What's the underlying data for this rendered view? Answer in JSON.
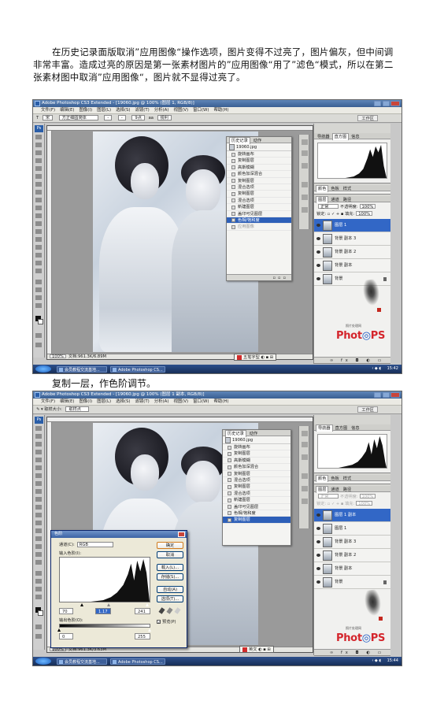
{
  "intro_text": "在历史记录面版取消”应用图像“操作选项，图片变得不过亮了，图片偏灰，但中间调非常丰富。造成过亮的原因是第一张素材图片的”应用图像“用了”滤色“模式，所以在第二张素材图中取消”应用图像“，图片就不显得过亮了。",
  "caption2": "复制一层，作色阶调节。",
  "screens": [
    {
      "title": "Adobe Photoshop CS3 Extended - [19060.jpg @ 100% (图层 1, RGB/8)]",
      "menu": [
        "文件(F)",
        "编辑(E)",
        "图像(I)",
        "图层(L)",
        "选择(S)",
        "滤镜(T)",
        "分析(A)",
        "视图(V)",
        "窗口(W)",
        "帮助(H)"
      ],
      "options": [
        "T",
        "宋",
        "方正细圆简体",
        "-",
        "-",
        "9点",
        "aa",
        "锐利"
      ],
      "workspace": "工作区",
      "history": {
        "tabs": [
          "历史记录",
          "动作"
        ],
        "snapshot": "19060.jpg",
        "rows": [
          {
            "label": "旋转画布",
            "state": ""
          },
          {
            "label": "复制图层",
            "state": ""
          },
          {
            "label": "高斯模糊",
            "state": ""
          },
          {
            "label": "颜色加深混合",
            "state": ""
          },
          {
            "label": "复制图层",
            "state": ""
          },
          {
            "label": "混合选项",
            "state": ""
          },
          {
            "label": "复制图层",
            "state": ""
          },
          {
            "label": "混合选项",
            "state": ""
          },
          {
            "label": "新建图层",
            "state": ""
          },
          {
            "label": "盖印可见图层",
            "state": ""
          },
          {
            "label": "色相/饱和度",
            "state": "sel"
          },
          {
            "label": "应用图像",
            "state": "dim"
          }
        ]
      },
      "nav_tabs": [
        "导航器",
        "直方图",
        "信息"
      ],
      "color_tabs": [
        "颜色",
        "色板",
        "样式"
      ],
      "layers_tabs": [
        "图层",
        "通道",
        "路径"
      ],
      "blend": "正常",
      "opacity_label": "不透明度:",
      "opacity": "100%",
      "lock_label": "锁定:",
      "fill_label": "填充:",
      "fill": "100%",
      "layers": [
        {
          "name": "图层 1",
          "sel": true
        },
        {
          "name": "背景 副本 3",
          "sel": false
        },
        {
          "name": "背景 副本 2",
          "sel": false
        },
        {
          "name": "背景 副本",
          "sel": false
        },
        {
          "name": "背景",
          "sel": false,
          "lock": true
        }
      ],
      "zoom": "100%",
      "doc": "文档:961.3K/6.89M",
      "lang": "五笔字型",
      "logo_sub": "照片处理网",
      "logo_a": "Phot",
      "logo_b": "PS",
      "start_task": "会员教程交流基地...",
      "ps_task": "Adobe Photoshop CS...",
      "clock": "15:42"
    },
    {
      "title": "Adobe Photoshop CS3 Extended - [19060.jpg @ 100% (图层 1 副本, RGB/8)]",
      "menu": [
        "文件(F)",
        "编辑(E)",
        "图像(I)",
        "图层(L)",
        "选择(S)",
        "滤镜(T)",
        "分析(A)",
        "视图(V)",
        "窗口(W)",
        "帮助(H)"
      ],
      "options": [
        "取样大小:",
        "取样点"
      ],
      "workspace": "工作区",
      "history": {
        "tabs": [
          "历史记录",
          "动作"
        ],
        "snapshot": "19060.jpg",
        "rows": [
          {
            "label": "旋转画布",
            "state": ""
          },
          {
            "label": "复制图层",
            "state": ""
          },
          {
            "label": "高斯模糊",
            "state": ""
          },
          {
            "label": "颜色加深混合",
            "state": ""
          },
          {
            "label": "复制图层",
            "state": ""
          },
          {
            "label": "混合选项",
            "state": ""
          },
          {
            "label": "复制图层",
            "state": ""
          },
          {
            "label": "混合选项",
            "state": ""
          },
          {
            "label": "新建图层",
            "state": ""
          },
          {
            "label": "盖印可见图层",
            "state": ""
          },
          {
            "label": "色相/饱和度",
            "state": ""
          },
          {
            "label": "复制图层",
            "state": "sel"
          }
        ]
      },
      "nav_tabs": [
        "导航器",
        "直方图",
        "信息"
      ],
      "color_tabs": [
        "颜色",
        "色板",
        "样式"
      ],
      "layers_tabs": [
        "图层",
        "通道",
        "路径"
      ],
      "blend": "正常",
      "opacity_label": "不透明度:",
      "opacity": "100%",
      "lock_label": "锁定:",
      "fill_label": "填充:",
      "fill": "100%",
      "layers": [
        {
          "name": "图层 1 副本",
          "sel": true
        },
        {
          "name": "图层 1",
          "sel": false
        },
        {
          "name": "背景 副本 3",
          "sel": false
        },
        {
          "name": "背景 副本 2",
          "sel": false
        },
        {
          "name": "背景 副本",
          "sel": false
        },
        {
          "name": "背景",
          "sel": false,
          "lock": true
        }
      ],
      "zoom": "100%",
      "doc": "文档:961.3K/3.63M",
      "lang": "英文",
      "logo_sub": "照片处理网",
      "logo_a": "Phot",
      "logo_b": "PS",
      "start_task": "会员教程交流基地...",
      "ps_task": "Adobe Photoshop CS...",
      "clock": "15:44",
      "levels": {
        "title": "色阶",
        "channel_label": "通道(C):",
        "channel": "RGB",
        "input_label": "输入色阶(I):",
        "input_black": "70",
        "input_gray": "1.17",
        "input_white": "241",
        "output_label": "输出色阶(O):",
        "output_black": "0",
        "output_white": "255",
        "buttons": [
          "确定",
          "取消",
          "载入(L)...",
          "存储(S)...",
          "自动(A)",
          "选项(T)..."
        ],
        "preview": "预览(P)"
      }
    }
  ]
}
